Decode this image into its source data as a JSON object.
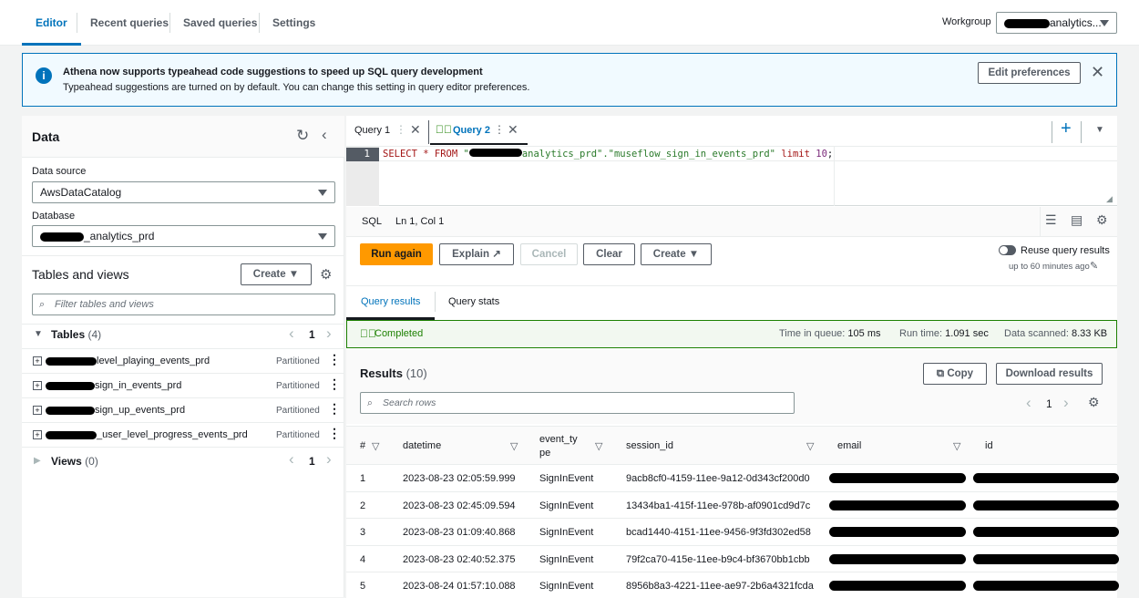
{
  "top_tabs": [
    {
      "label": "Editor",
      "active": true
    },
    {
      "label": "Recent queries"
    },
    {
      "label": "Saved queries"
    },
    {
      "label": "Settings"
    }
  ],
  "workgroup": {
    "label": "Workgroup",
    "value": "analytics..."
  },
  "banner": {
    "title": "Athena now supports typeahead code suggestions to speed up SQL query development",
    "body": "Typeahead suggestions are turned on by default. You can change this setting in query editor preferences.",
    "button": "Edit preferences",
    "icon": "info-icon"
  },
  "data_panel": {
    "title": "Data",
    "data_source_label": "Data source",
    "data_source": "AwsDataCatalog",
    "database_label": "Database",
    "database": "_analytics_prd",
    "tables_views_title": "Tables and views",
    "create": "Create",
    "filter_placeholder": "Filter tables and views",
    "tables_label": "Tables",
    "tables_count": "(4)",
    "page": "1",
    "tables": [
      {
        "name": "level_playing_events_prd",
        "badge": "Partitioned"
      },
      {
        "name": "sign_in_events_prd",
        "badge": "Partitioned"
      },
      {
        "name": "sign_up_events_prd",
        "badge": "Partitioned"
      },
      {
        "name": "_user_level_progress_events_prd",
        "badge": "Partitioned"
      }
    ],
    "views_label": "Views",
    "views_count": "(0)",
    "views_page": "1"
  },
  "editor": {
    "tabs": [
      {
        "label": "Query 1"
      },
      {
        "label": "Query 2",
        "active": true
      }
    ],
    "line_number": "1",
    "sql_a": "SELECT * FROM ",
    "sql_b": "\"",
    "sql_c": "analytics_prd\".\"museflow_sign_in_events_prd\"",
    "sql_d": " limit ",
    "sql_e": "10",
    "sql_f": ";",
    "lang": "SQL",
    "cursor": "Ln 1, Col 1"
  },
  "actions": {
    "run": "Run again",
    "explain": "Explain",
    "cancel": "Cancel",
    "clear": "Clear",
    "create": "Create",
    "reuse": "Reuse query results",
    "reuse_sub": "up to 60 minutes ago",
    "reuse_on": false
  },
  "result_tabs": [
    {
      "label": "Query results",
      "active": true
    },
    {
      "label": "Query stats"
    }
  ],
  "status": {
    "label": "Completed",
    "queue_label": "Time in queue:",
    "queue": "105 ms",
    "run_label": "Run time:",
    "run": "1.091 sec",
    "scan_label": "Data scanned:",
    "scan": "8.33 KB"
  },
  "results": {
    "title": "Results",
    "count": "(10)",
    "copy": "Copy",
    "download": "Download results",
    "search_placeholder": "Search rows",
    "page": "1",
    "columns": [
      "#",
      "datetime",
      "event_type",
      "session_id",
      "email",
      "id"
    ],
    "rows": [
      [
        "1",
        "2023-08-23 02:05:59.999",
        "SignInEvent",
        "9acb8cf0-4159-11ee-9a12-0d343cf200d0"
      ],
      [
        "2",
        "2023-08-23 02:45:09.594",
        "SignInEvent",
        "13434ba1-415f-11ee-978b-af0901cd9d7c"
      ],
      [
        "3",
        "2023-08-23 01:09:40.868",
        "SignInEvent",
        "bcad1440-4151-11ee-9456-9f3fd302ed58"
      ],
      [
        "4",
        "2023-08-23 02:40:52.375",
        "SignInEvent",
        "79f2ca70-415e-11ee-b9c4-bf3670bb1cbb"
      ],
      [
        "5",
        "2023-08-24 01:57:10.088",
        "SignInEvent",
        "8956b8a3-4221-11ee-ae97-2b6a4321fcda"
      ]
    ]
  },
  "colors": {
    "accent": "#0073bb",
    "primary_button": "#ff9900",
    "success": "#1d8102"
  }
}
